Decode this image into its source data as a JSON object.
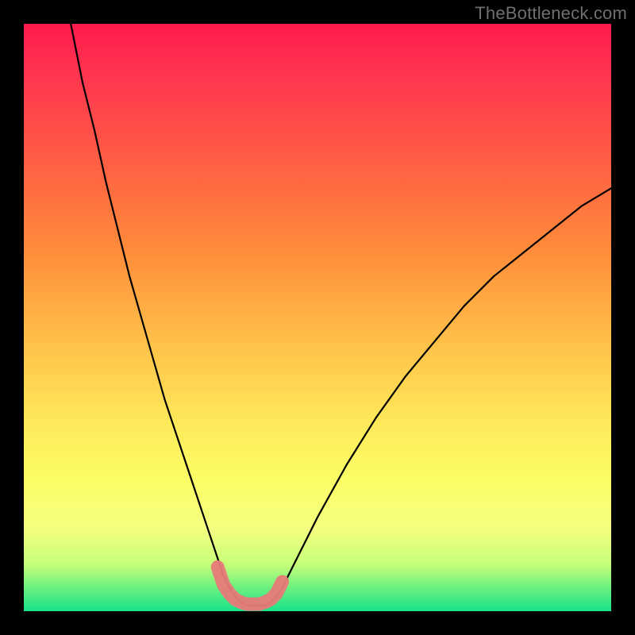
{
  "watermark": {
    "text": "TheBottleneck.com"
  },
  "colors": {
    "frame": "#000000",
    "curve": "#000000",
    "marker": "#e77a78",
    "gradient_stops": [
      "#ff1a4d",
      "#ff3350",
      "#ff5a45",
      "#ff8a3a",
      "#ffc34a",
      "#ffe95a",
      "#fbff66",
      "#f4ff80",
      "#c7ff7a",
      "#6bf07f",
      "#17e38a"
    ]
  },
  "chart_data": {
    "type": "line",
    "title": "",
    "xlabel": "",
    "ylabel": "",
    "xlim": [
      0,
      100
    ],
    "ylim": [
      0,
      100
    ],
    "legend": false,
    "grid": false,
    "series": [
      {
        "name": "bottleneck-curve",
        "x": [
          8,
          10,
          12,
          14,
          16,
          18,
          20,
          22,
          24,
          26,
          28,
          30,
          32,
          33,
          34,
          35,
          36,
          37,
          38,
          39,
          40,
          41,
          42,
          43,
          44,
          46,
          48,
          50,
          55,
          60,
          65,
          70,
          75,
          80,
          85,
          90,
          95,
          100
        ],
        "y": [
          100,
          90,
          82,
          73,
          65,
          57,
          50,
          43,
          36,
          30,
          24,
          18,
          12,
          9,
          6,
          4,
          2.5,
          1.5,
          1,
          1,
          1,
          1,
          1.5,
          2.5,
          4,
          8,
          12,
          16,
          25,
          33,
          40,
          46,
          52,
          57,
          61,
          65,
          69,
          72
        ]
      },
      {
        "name": "optimal-range-markers",
        "x": [
          33,
          34,
          35,
          36,
          37,
          38,
          39,
          40,
          41,
          42,
          43,
          44
        ],
        "y": [
          7.5,
          4.5,
          3,
          2,
          1.5,
          1.2,
          1.2,
          1.2,
          1.5,
          2,
          3,
          5
        ]
      }
    ]
  }
}
